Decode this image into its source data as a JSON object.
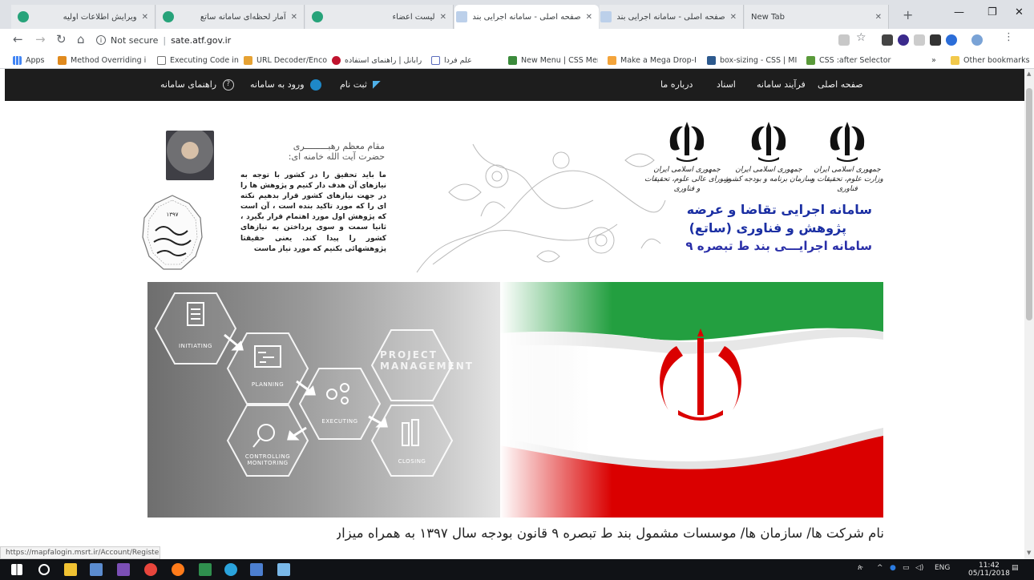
{
  "browser": {
    "tabs": [
      {
        "label": "ویرایش اطلاعات اولیه",
        "active": false
      },
      {
        "label": "آمار لحظه‌ای سامانه ساتع",
        "active": false
      },
      {
        "label": "لیست اعضاء",
        "active": false
      },
      {
        "label": "صفحه اصلی - سامانه اجرایی بند",
        "active": true
      },
      {
        "label": "صفحه اصلی - سامانه اجرایی بند",
        "active": false
      },
      {
        "label": "New Tab",
        "active": false
      }
    ],
    "security_label": "Not secure",
    "url": "sate.atf.gov.ir",
    "bookmarks": [
      "Apps",
      "Method Overriding i",
      "Executing Code in A",
      "URL Decoder/Encode",
      "رابانل | راهنمای استفاده",
      "علم فردا",
      "New Menu | CSS Men",
      "Make a Mega Drop-D",
      "box-sizing - CSS | MI",
      "CSS :after Selector",
      "Other bookmarks"
    ],
    "overflow_label": "»"
  },
  "site": {
    "nav_right": [
      "صفحه اصلی",
      "فرآیند سامانه",
      "اسناد",
      "درباره ما"
    ],
    "nav_left": {
      "register": "ثبت نام",
      "login": "ورود به سامانه",
      "help": "راهنمای سامانه"
    },
    "leader_title_line1": "مقام معظم رهبـــــــــری",
    "leader_title_line2": "حضرت آیت الله خامنه ای:",
    "quote": "ما باید تحقیق را در کشور با توجه به نیازهای آن هدف دار کنیم و پژوهش ها را در جهت نیازهای کشور قرار بدهیم نکته ای را که مورد تاکید بنده است ، آن است که پژوهش اول مورد اهتمام قرار بگیرد ، ثانیا سمت و سوی پرداختن به نیازهای کشور را پیدا کند. یعنی حقیقتا پژوهشهائی بکنیم که مورد نیاز ماست",
    "badge_year": "۱۳۹۷",
    "badge_text": "سال حمایت از کالای ایرانی",
    "emblem_captions": [
      "جمهوری اسلامی ایران وزارت علوم، تحقیقات و فناوری",
      "جمهوری اسلامی ایران سازمان برنامه و بودجه کشور",
      "جمهوری اسلامی ایران شورای عالی علوم، تحقیقات و فناوری"
    ],
    "brand_line1": "سامانه اجرایی تقاضا و عرضه",
    "brand_line2": "پژوهش و فناوری (ساتع)",
    "brand_line3": "سامانه اجرایـــی بند ط تبصره ۹",
    "banner": {
      "hexagons": [
        "INITIATING",
        "PLANNING",
        "EXECUTING",
        "CONTROLLING MONITORING",
        "CLOSING"
      ],
      "project_line1": "PROJECT",
      "project_line2": "MANAGEMENT"
    },
    "subtitle": "نام شرکت ها/ سازمان ها/ موسسات مشمول بند ط تبصره ۹ قانون بودجه سال ۱۳۹۷ به همراه میزان اعتبار"
  },
  "status_url": "https://mapfalogin.msrt.ir/Account/Register",
  "taskbar": {
    "lang": "ENG",
    "time": "11:42",
    "date": "05/11/2018"
  },
  "colors": {
    "nav_bg": "#1d1d1d",
    "brand_blue": "#1b2fa3",
    "flag_green": "#239f40",
    "flag_red": "#da0000"
  }
}
